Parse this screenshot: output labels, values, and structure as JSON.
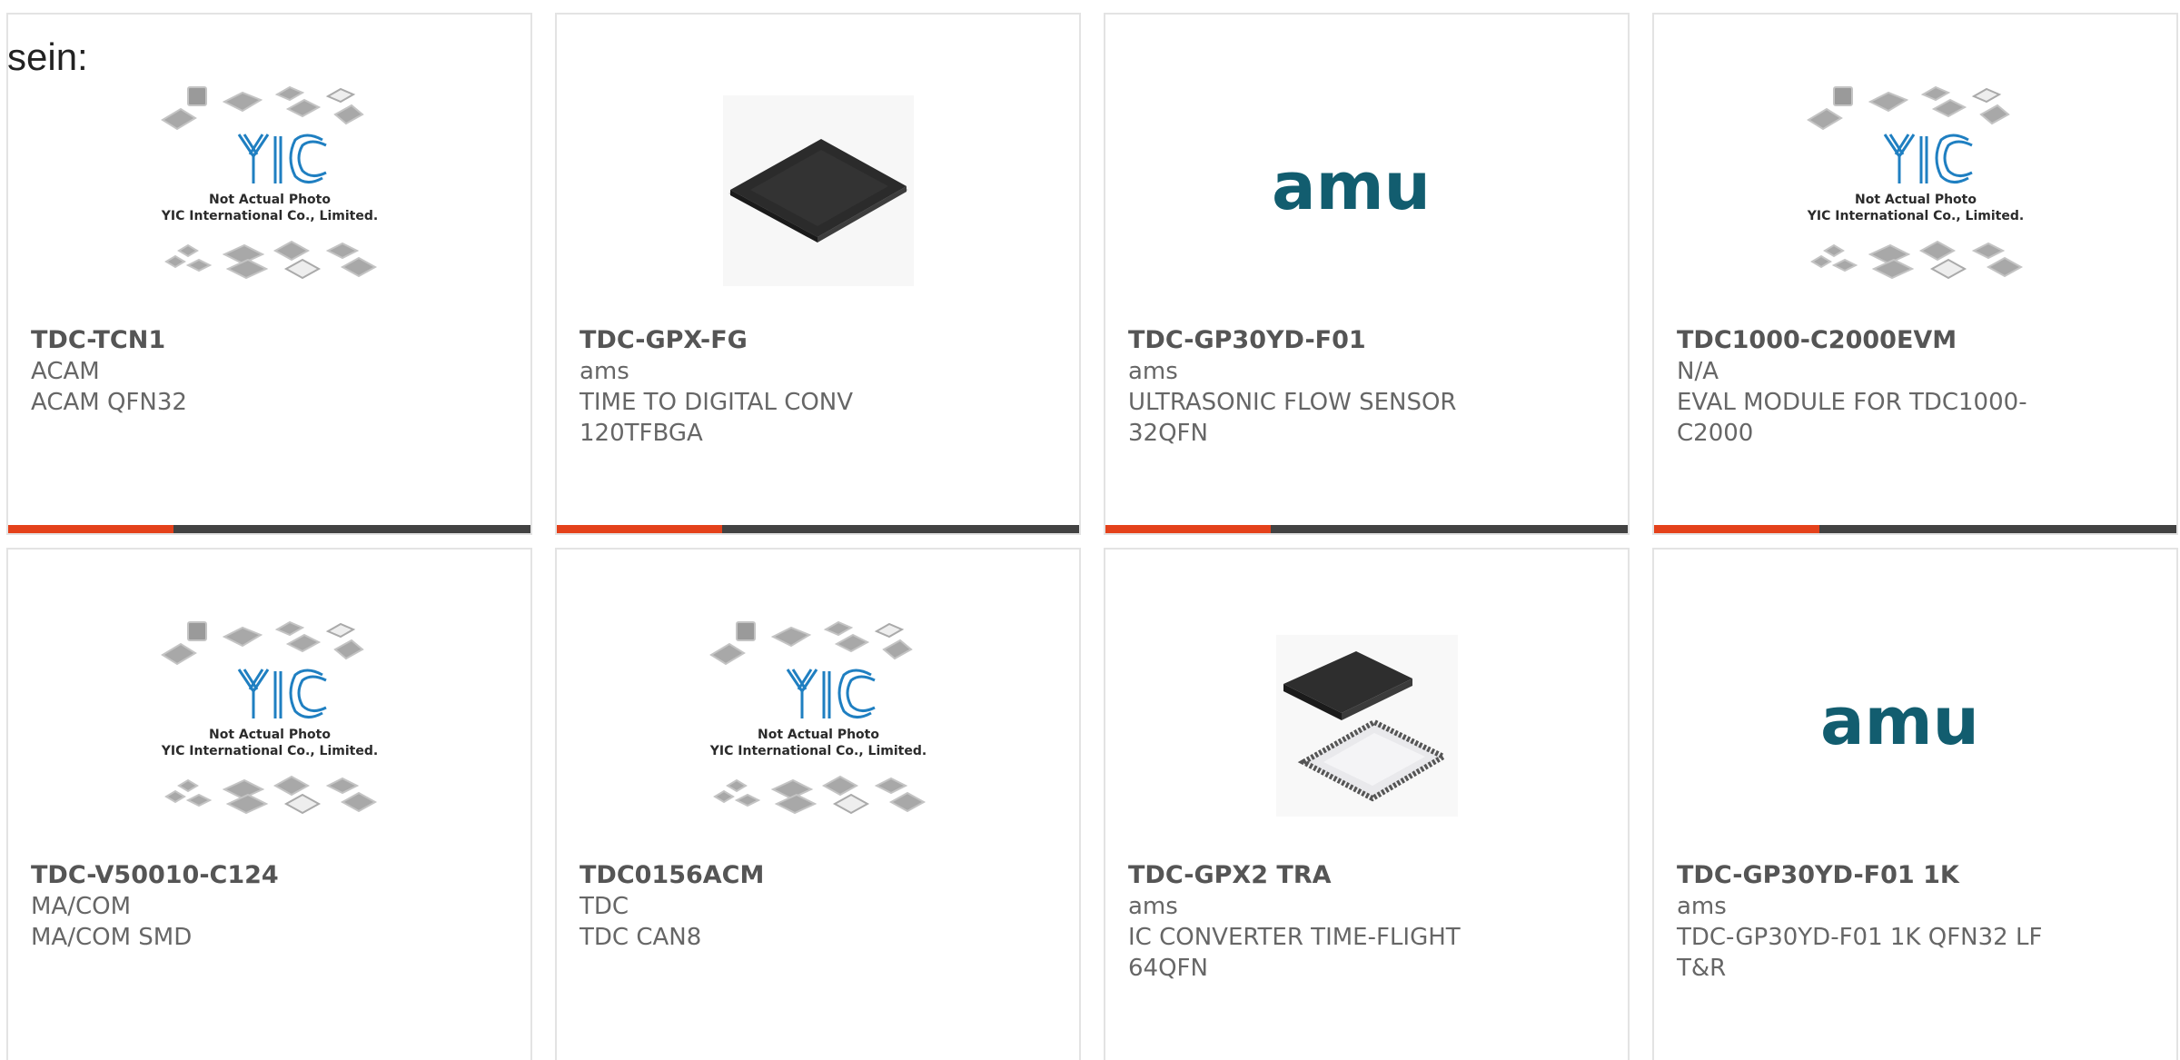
{
  "intro_text": "sein:",
  "placeholder": {
    "line1": "Not Actual Photo",
    "line2": "YIC International Co., Limited."
  },
  "brand_logo": "amu",
  "colors": {
    "accent": "#e4411b",
    "bar_dark": "#424242",
    "yic_blue": "#1f7fc1",
    "ams_teal": "#125d6f"
  },
  "products": [
    {
      "part": "TDC-TCN1",
      "manufacturer": "ACAM",
      "description": "ACAM QFN32",
      "image": "yic-placeholder-image"
    },
    {
      "part": "TDC-GPX-FG",
      "manufacturer": "ams",
      "description": "TIME TO DIGITAL CONV 120TFBGA",
      "image": "chip-photo"
    },
    {
      "part": "TDC-GP30YD-F01",
      "manufacturer": "ams",
      "description": "ULTRASONIC FLOW SENSOR 32QFN",
      "image": "ams-logo"
    },
    {
      "part": "TDC1000-C2000EVM",
      "manufacturer": "N/A",
      "description": "EVAL MODULE FOR TDC1000-C2000",
      "image": "yic-placeholder-image"
    },
    {
      "part": "TDC-V50010-C124",
      "manufacturer": "MA/COM",
      "description": "MA/COM SMD",
      "image": "yic-placeholder-image"
    },
    {
      "part": "TDC0156ACM",
      "manufacturer": "TDC",
      "description": "TDC CAN8",
      "image": "yic-placeholder-image"
    },
    {
      "part": "TDC-GPX2 TRA",
      "manufacturer": "ams",
      "description": "IC CONVERTER TIME-FLIGHT 64QFN",
      "image": "qfn-chip-photo"
    },
    {
      "part": "TDC-GP30YD-F01 1K",
      "manufacturer": "ams",
      "description": "TDC-GP30YD-F01 1K QFN32 LF T&R",
      "image": "ams-logo"
    }
  ]
}
